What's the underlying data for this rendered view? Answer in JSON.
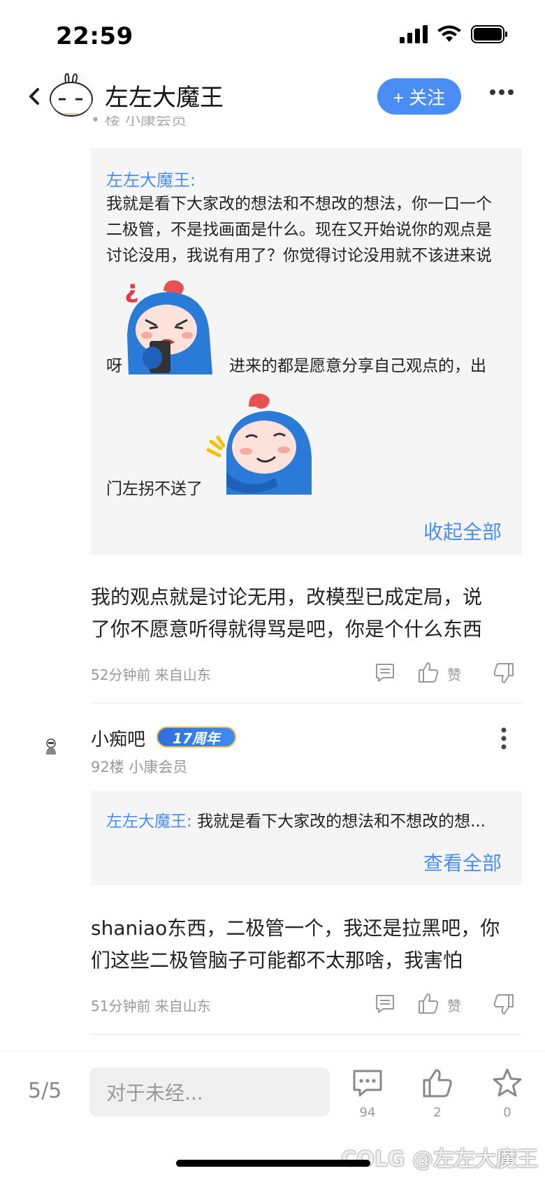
{
  "status_bar": {
    "time": "22:59"
  },
  "header": {
    "title": "左左大魔王",
    "follow_label": "+ 关注",
    "cut_text": "• 楼  小康会员"
  },
  "post1": {
    "quote": {
      "author": "左左大魔王:",
      "line1": "我就是看下大家改的想法和不想改的想法，你一口一个",
      "line2": "二极管，不是找画面是什么。现在又开始说你的观点是",
      "line3": "讨论没用，我说有用了？你觉得讨论没用就不该进来说",
      "line4_a": "呀",
      "line4_b": "进来的都是愿意分享自己观点的，出",
      "line5": "门左拐不送了",
      "sticker1_icon": "angry-phone-sticker-icon",
      "sticker2_icon": "shy-hug-sticker-icon",
      "collapse_label": "收起全部"
    },
    "text_line1": "我的观点就是讨论无用，改模型已成定局，说",
    "text_line2": "了你不愿意听得就得骂是吧，你是个什么东西",
    "meta": "52分钟前 来自山东",
    "like_label": "赞"
  },
  "post2": {
    "username": "小痴吧",
    "badge": "17周年",
    "floor_info": "92楼  小康会员",
    "quote": {
      "author": "左左大魔王:",
      "text": "我就是看下大家改的想法和不想改的想...",
      "expand_label": "查看全部"
    },
    "text_line1": "shaniao东西，二极管一个，我还是拉黑吧，你",
    "text_line2": "们这些二极管脑子可能都不太那啥，我害怕",
    "meta": "51分钟前 来自山东",
    "like_label": "赞"
  },
  "bottom_bar": {
    "page": "5/5",
    "input_placeholder": "对于未经...",
    "comment_count": "94",
    "like_count": "2",
    "star_count": "0"
  },
  "watermark": "COLG @左左大魔王",
  "colors": {
    "accent": "#4a8ef5",
    "quote_bg": "#f5f5f5",
    "meta": "#999999"
  }
}
